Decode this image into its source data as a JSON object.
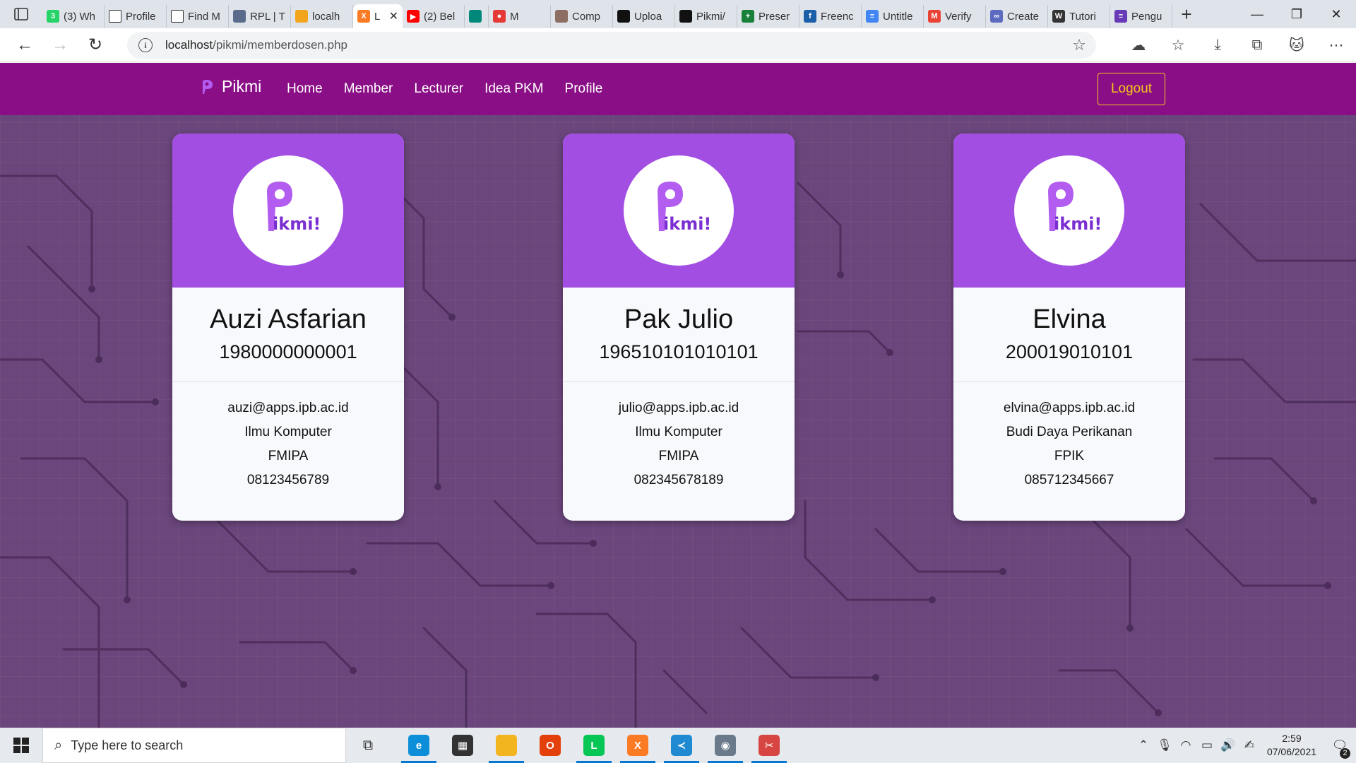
{
  "browser": {
    "tabs": [
      {
        "label": "(3) Wh",
        "icon": "whatsapp-icon",
        "color": "#25d366",
        "glyph": "3"
      },
      {
        "label": "Profile",
        "icon": "page-icon",
        "color": "#ffffff",
        "glyph": ""
      },
      {
        "label": "Find M",
        "icon": "page-icon",
        "color": "#ffffff",
        "glyph": ""
      },
      {
        "label": "RPL | T",
        "icon": "rpl-icon",
        "color": "#5b6b8c",
        "glyph": ""
      },
      {
        "label": "localh",
        "icon": "phpmyadmin-icon",
        "color": "#f2a41c",
        "glyph": ""
      },
      {
        "label": "Le",
        "icon": "xampp-icon",
        "color": "#fb7a24",
        "glyph": "X",
        "active": true
      },
      {
        "label": "(2) Bel",
        "icon": "youtube-icon",
        "color": "#ff0000",
        "glyph": "▶"
      },
      {
        "label": "",
        "icon": "google-meet-icon",
        "color": "#00897b",
        "glyph": ""
      },
      {
        "label": "M",
        "icon": "record-icon",
        "color": "#e53935",
        "glyph": "●"
      },
      {
        "label": "Comp",
        "icon": "compressor-icon",
        "color": "#8d6e63",
        "glyph": ""
      },
      {
        "label": "Uploa",
        "icon": "github-icon",
        "color": "#111111",
        "glyph": ""
      },
      {
        "label": "Pikmi/",
        "icon": "github-icon",
        "color": "#111111",
        "glyph": ""
      },
      {
        "label": "Preser",
        "icon": "google-slides-plus-icon",
        "color": "#188038",
        "glyph": "+"
      },
      {
        "label": "Freenc",
        "icon": "freenom-icon",
        "color": "#1a5fa8",
        "glyph": "f"
      },
      {
        "label": "Untitle",
        "icon": "google-docs-icon",
        "color": "#4285f4",
        "glyph": "≡"
      },
      {
        "label": "Verify",
        "icon": "gmail-icon",
        "color": "#ea4335",
        "glyph": "M"
      },
      {
        "label": "Create",
        "icon": "infinity-icon",
        "color": "#5c6bc0",
        "glyph": "∞"
      },
      {
        "label": "Tutori",
        "icon": "w3schools-icon",
        "color": "#333333",
        "glyph": "W"
      },
      {
        "label": "Pengu",
        "icon": "forms-icon",
        "color": "#673ab7",
        "glyph": "≡"
      }
    ],
    "url_host": "localhost",
    "url_path": "/pikmi/memberdosen.php"
  },
  "site": {
    "brand": "Pikmi",
    "nav": [
      "Home",
      "Member",
      "Lecturer",
      "Idea PKM",
      "Profile"
    ],
    "logout_label": "Logout",
    "colors": {
      "navbar": "#8a0f86",
      "card_header": "#a24ee3",
      "logout": "#f5c518"
    }
  },
  "lecturers": [
    {
      "name": "Auzi Asfarian",
      "nip": "1980000000001",
      "email": "auzi@apps.ipb.ac.id",
      "department": "Ilmu Komputer",
      "faculty": "FMIPA",
      "phone": "08123456789"
    },
    {
      "name": "Pak Julio",
      "nip": "196510101010101",
      "email": "julio@apps.ipb.ac.id",
      "department": "Ilmu Komputer",
      "faculty": "FMIPA",
      "phone": "082345678189"
    },
    {
      "name": "Elvina",
      "nip": "200019010101",
      "email": "elvina@apps.ipb.ac.id",
      "department": "Budi Daya Perikanan",
      "faculty": "FPIK",
      "phone": "085712345667"
    }
  ],
  "logo_text": "ikmi!",
  "taskbar": {
    "search_placeholder": "Type here to search",
    "apps": [
      {
        "icon": "edge-icon",
        "color": "#0c8fd8",
        "glyph": "e",
        "running": true
      },
      {
        "icon": "store-icon",
        "color": "#333333",
        "glyph": "▦",
        "running": false
      },
      {
        "icon": "file-explorer-icon",
        "color": "#f3b51f",
        "glyph": "",
        "running": true
      },
      {
        "icon": "office-icon",
        "color": "#e3400b",
        "glyph": "O",
        "running": false
      },
      {
        "icon": "line-icon",
        "color": "#06c755",
        "glyph": "L",
        "running": true
      },
      {
        "icon": "xampp-icon",
        "color": "#fb7a24",
        "glyph": "X",
        "running": true
      },
      {
        "icon": "vscode-icon",
        "color": "#1f8ad2",
        "glyph": "≺",
        "running": true
      },
      {
        "icon": "figure-app-icon",
        "color": "#6a7a8a",
        "glyph": "◉",
        "running": true
      },
      {
        "icon": "snipping-tool-icon",
        "color": "#d64541",
        "glyph": "✂",
        "running": true
      }
    ],
    "time": "2:59",
    "date": "07/06/2021",
    "notifications": "2"
  }
}
